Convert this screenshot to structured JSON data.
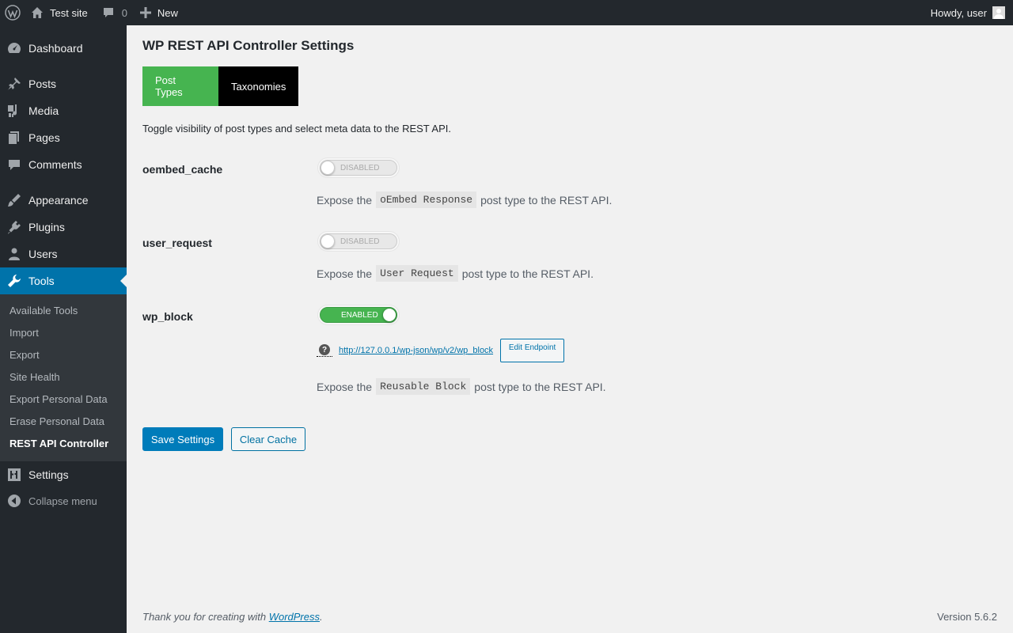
{
  "admin_bar": {
    "site_name": "Test site",
    "comment_count": "0",
    "new_label": "New",
    "howdy": "Howdy, user"
  },
  "sidebar": {
    "items": [
      {
        "label": "Dashboard",
        "icon": "dashboard-icon"
      },
      {
        "label": "Posts",
        "icon": "pin-icon"
      },
      {
        "label": "Media",
        "icon": "media-icon"
      },
      {
        "label": "Pages",
        "icon": "pages-icon"
      },
      {
        "label": "Comments",
        "icon": "comment-icon"
      },
      {
        "label": "Appearance",
        "icon": "brush-icon"
      },
      {
        "label": "Plugins",
        "icon": "plug-icon"
      },
      {
        "label": "Users",
        "icon": "user-icon"
      },
      {
        "label": "Tools",
        "icon": "wrench-icon"
      },
      {
        "label": "Settings",
        "icon": "settings-icon"
      }
    ],
    "submenu": [
      "Available Tools",
      "Import",
      "Export",
      "Site Health",
      "Export Personal Data",
      "Erase Personal Data",
      "REST API Controller"
    ],
    "collapse_label": "Collapse menu"
  },
  "page": {
    "title": "WP REST API Controller Settings",
    "tabs": [
      "Post Types",
      "Taxonomies"
    ],
    "intro": "Toggle visibility of post types and select meta data to the REST API.",
    "rows": [
      {
        "name": "oembed_cache",
        "toggle": "DISABLED",
        "desc_pre": "Expose the",
        "code": "oEmbed Response",
        "desc_post": "post type to the REST API."
      },
      {
        "name": "user_request",
        "toggle": "DISABLED",
        "desc_pre": "Expose the",
        "code": "User Request",
        "desc_post": "post type to the REST API."
      },
      {
        "name": "wp_block",
        "toggle": "ENABLED",
        "desc_pre": "Expose the",
        "code": "Reusable Block",
        "desc_post": "post type to the REST API."
      }
    ],
    "endpoint": {
      "help": "?",
      "url": "http://127.0.0.1/wp-json/wp/v2/wp_block",
      "edit_label": "Edit Endpoint"
    },
    "save_label": "Save Settings",
    "clear_label": "Clear Cache"
  },
  "footer": {
    "thanks_pre": "Thank you for creating with",
    "thanks_link": "WordPress",
    "thanks_post": ".",
    "version": "Version 5.6.2"
  },
  "colors": {
    "admin_bg": "#23282d",
    "accent": "#0073aa",
    "tab_active": "#46b450",
    "toggle_on": "#46b450"
  }
}
